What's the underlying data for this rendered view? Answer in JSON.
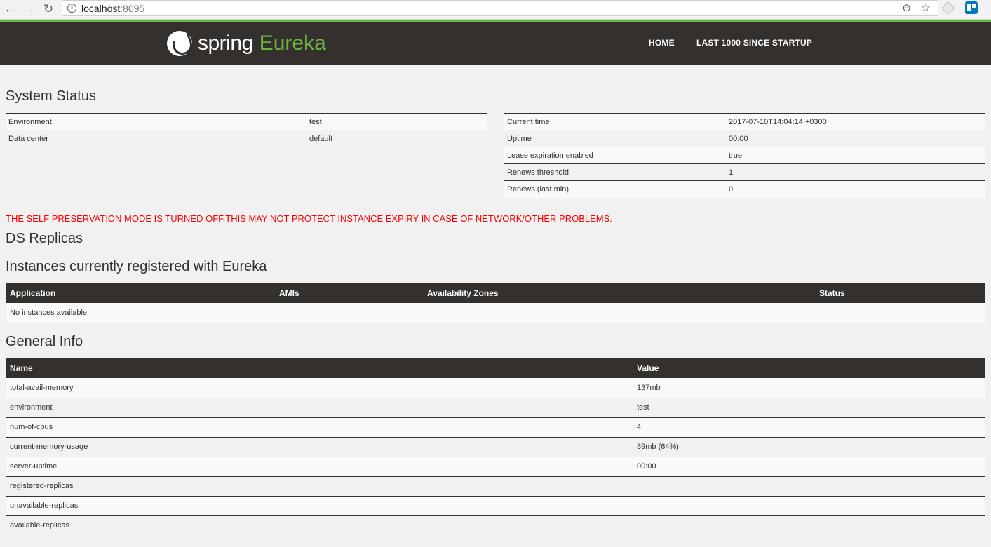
{
  "browser": {
    "url_host": "localhost",
    "url_port": ":8095",
    "back_glyph": "←",
    "forward_glyph": "→",
    "reload_glyph": "↻",
    "info_glyph": "i",
    "zoom_glyph": "⊖",
    "star_glyph": "☆"
  },
  "navbar": {
    "brand_spring": "spring",
    "brand_eureka": "Eureka",
    "links": [
      "HOME",
      "LAST 1000 SINCE STARTUP"
    ]
  },
  "system_status": {
    "title": "System Status",
    "left": [
      {
        "label": "Environment",
        "value": "test"
      },
      {
        "label": "Data center",
        "value": "default"
      }
    ],
    "right": [
      {
        "label": "Current time",
        "value": "2017-07-10T14:04:14 +0300"
      },
      {
        "label": "Uptime",
        "value": "00:00"
      },
      {
        "label": "Lease expiration enabled",
        "value": "true"
      },
      {
        "label": "Renews threshold",
        "value": "1"
      },
      {
        "label": "Renews (last min)",
        "value": "0"
      }
    ]
  },
  "warning": "THE SELF PRESERVATION MODE IS TURNED OFF.THIS MAY NOT PROTECT INSTANCE EXPIRY IN CASE OF NETWORK/OTHER PROBLEMS.",
  "ds_replicas": {
    "title": "DS Replicas"
  },
  "instances": {
    "title": "Instances currently registered with Eureka",
    "headers": [
      "Application",
      "AMIs",
      "Availability Zones",
      "Status"
    ],
    "empty_text": "No instances available"
  },
  "general_info": {
    "title": "General Info",
    "headers": [
      "Name",
      "Value"
    ],
    "rows": [
      {
        "name": "total-avail-memory",
        "value": "137mb"
      },
      {
        "name": "environment",
        "value": "test"
      },
      {
        "name": "num-of-cpus",
        "value": "4"
      },
      {
        "name": "current-memory-usage",
        "value": "89mb (64%)"
      },
      {
        "name": "server-uptime",
        "value": "00:00"
      },
      {
        "name": "registered-replicas",
        "value": ""
      },
      {
        "name": "unavailable-replicas",
        "value": ""
      },
      {
        "name": "available-replicas",
        "value": ""
      }
    ]
  },
  "colors": {
    "navbar_bg": "#34302d",
    "accent_green": "#6db33f",
    "warning_red": "#ff0000",
    "page_bg": "#f1f1f1"
  }
}
